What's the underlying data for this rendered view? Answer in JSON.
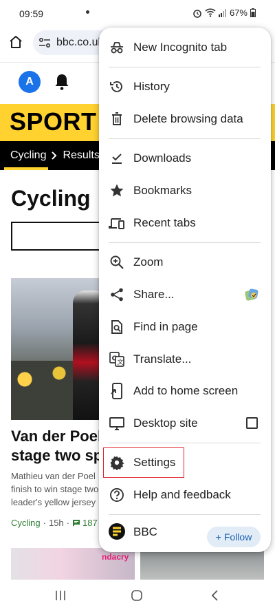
{
  "status_bar": {
    "time": "09:59",
    "battery": "67%"
  },
  "url_bar": {
    "url": "bbc.co.uk"
  },
  "page": {
    "avatar_initial": "A",
    "section_title": "SPORT",
    "breadcrumb": [
      "Cycling",
      "Results"
    ],
    "heading": "Cycling",
    "article": {
      "headline_line1": "Van der Poel",
      "headline_line2": "stage two sp",
      "summary_line1": "Mathieu van der Poel",
      "summary_line2": "finish to win stage two",
      "summary_line3": "leader's yellow jersey",
      "tag": "Cycling",
      "age": "15h",
      "comments": "187"
    },
    "thumb_text": "ndacry"
  },
  "menu": {
    "items": [
      {
        "label": "New Incognito tab",
        "icon": "incognito-icon"
      },
      {
        "label": "History",
        "icon": "history-icon"
      },
      {
        "label": "Delete browsing data",
        "icon": "trash-icon"
      },
      {
        "label": "Downloads",
        "icon": "download-icon"
      },
      {
        "label": "Bookmarks",
        "icon": "star-icon"
      },
      {
        "label": "Recent tabs",
        "icon": "devices-icon"
      },
      {
        "label": "Zoom",
        "icon": "zoom-icon"
      },
      {
        "label": "Share...",
        "icon": "share-icon"
      },
      {
        "label": "Find in page",
        "icon": "find-icon"
      },
      {
        "label": "Translate...",
        "icon": "translate-icon"
      },
      {
        "label": "Add to home screen",
        "icon": "add-home-icon"
      },
      {
        "label": "Desktop site",
        "icon": "desktop-icon"
      },
      {
        "label": "Settings",
        "icon": "gear-icon"
      },
      {
        "label": "Help and feedback",
        "icon": "help-icon"
      }
    ],
    "site_label": "BBC",
    "follow_label": "Follow"
  },
  "colors": {
    "sport_yellow": "#ffd230",
    "highlight_red": "#e0242b",
    "avatar_blue": "#1a73e8"
  }
}
